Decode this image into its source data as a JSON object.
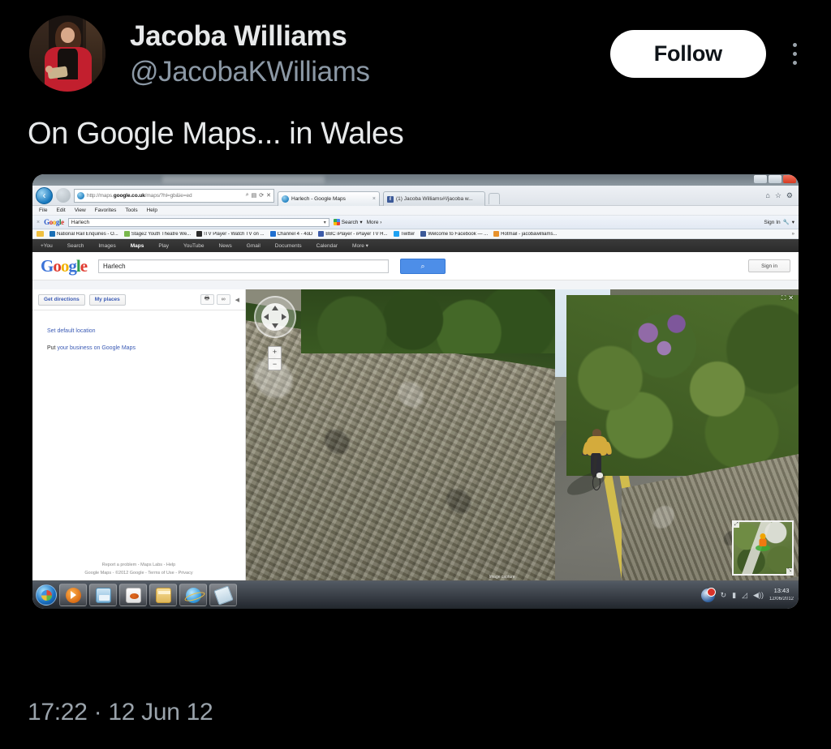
{
  "tweet": {
    "display_name": "Jacoba Williams",
    "handle": "@JacobaKWilliams",
    "follow_label": "Follow",
    "text": "On Google Maps... in Wales",
    "timestamp": "17:22 · 12 Jun 12",
    "avatar_alt": "avatar",
    "more_icon": "more-options-icon"
  },
  "browser": {
    "address_url_prefix": "http://maps.",
    "address_url_domain": "google.co.uk",
    "address_url_suffix": "/maps/?hl=gb&ie=ed",
    "tabs": [
      {
        "label": "Harlech - Google Maps",
        "active": true
      },
      {
        "label": "(1) Jacoba Williams#!/jacoba w...",
        "active": false
      }
    ],
    "menubar": [
      "File",
      "Edit",
      "View",
      "Favorites",
      "Tools",
      "Help"
    ],
    "google_toolbar": {
      "query": "Harlech",
      "search_label": "Search",
      "more_label": "More",
      "signin_label": "Sign In"
    },
    "favorites": [
      {
        "label": "National Rail Enquiries - O...",
        "color": "#1a6fb5"
      },
      {
        "label": "Stage2 Youth Theatre  We...",
        "color": "#79b84d"
      },
      {
        "label": "ITV Player - Watch TV on ...",
        "color": "#2b2b2b"
      },
      {
        "label": "Channel 4 - 4oD",
        "color": "#1f6fd0"
      },
      {
        "label": "BBC iPlayer - iPlayer TV H...",
        "color": "#3c5ba8"
      },
      {
        "label": "Twitter",
        "color": "#1da1f2"
      },
      {
        "label": "Welcome to Facebook — ...",
        "color": "#3b5998"
      },
      {
        "label": "Hotmail - jacobawilliams...",
        "color": "#e8922c"
      }
    ]
  },
  "maps": {
    "nav_items": [
      {
        "label": "+You",
        "active": false
      },
      {
        "label": "Search",
        "active": false
      },
      {
        "label": "Images",
        "active": false
      },
      {
        "label": "Maps",
        "active": true
      },
      {
        "label": "Play",
        "active": false
      },
      {
        "label": "YouTube",
        "active": false
      },
      {
        "label": "News",
        "active": false
      },
      {
        "label": "Gmail",
        "active": false
      },
      {
        "label": "Documents",
        "active": false
      },
      {
        "label": "Calendar",
        "active": false
      },
      {
        "label": "More ▾",
        "active": false
      }
    ],
    "logo": "Google",
    "search_value": "Harlech",
    "search_icon": "search-icon",
    "signin_label": "Sign in",
    "sidebar": {
      "get_directions": "Get directions",
      "my_places": "My places",
      "print_icon": "print-icon",
      "link_icon": "link-icon",
      "collapse_icon": "collapse-icon",
      "set_default_location": "Set default location",
      "put_business_prefix": "Put",
      "put_business_link": "your business on Google Maps",
      "footer_line1": "Report a problem - Maps Labs - Help",
      "footer_line2": "Google Maps - ©2012 Google - Terms of Use - Privacy"
    },
    "streetview": {
      "pan_icon": "pan-control-icon",
      "zoom_in": "+",
      "zoom_out": "−",
      "expand_icon": "expand-icon",
      "fullscreen_icon": "fullscreen-icon",
      "minimap_icon": "minimap-pegman-icon",
      "attribution": "Image capture"
    }
  },
  "taskbar": {
    "start_icon": "windows-start-orb",
    "items": [
      {
        "icon": "windows-media-player-icon"
      },
      {
        "icon": "scanner-icon"
      },
      {
        "icon": "paint-icon"
      },
      {
        "icon": "windows-explorer-icon"
      },
      {
        "icon": "internet-explorer-icon"
      },
      {
        "icon": "tools-icon"
      }
    ],
    "tray": {
      "action_center_icon": "action-center-flag-icon",
      "sync_icon": "sync-icon",
      "battery_icon": "battery-icon",
      "network_icon": "network-icon",
      "volume_icon": "volume-icon",
      "time": "13:43",
      "date": "12/06/2012"
    }
  },
  "colors": {
    "bg": "#000000",
    "text_primary": "#e7e9ea",
    "text_secondary": "#8b98a5",
    "follow_bg": "#ffffff",
    "follow_text": "#0f1419",
    "google_blue": "#4d8ee8",
    "maps_link": "#3b5bb5"
  }
}
